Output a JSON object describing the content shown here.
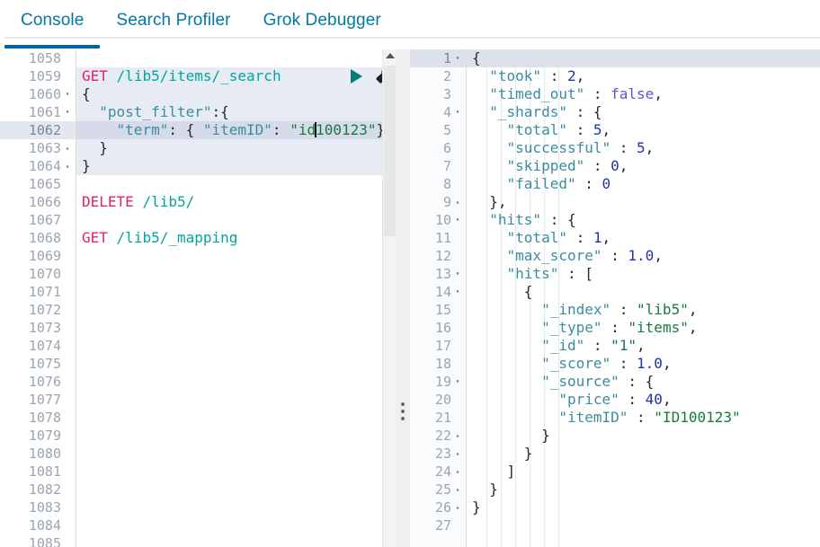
{
  "tabs": [
    {
      "label": "Console",
      "active": true
    },
    {
      "label": "Search Profiler",
      "active": false
    },
    {
      "label": "Grok Debugger",
      "active": false
    }
  ],
  "colors": {
    "accent": "#0062a6",
    "tab_text": "#0079a5",
    "method": "#e0216d",
    "url": "#00a69b",
    "json_key": "#3c8ca3",
    "string": "#177a3e",
    "number": "#2233aa",
    "boolean": "#6b4fc9",
    "play": "#017d73",
    "active_line": "#d5dbe8",
    "request_block": "#e7ebf4"
  },
  "icons": {
    "play": "play-icon",
    "wrench": "wrench-icon",
    "scroll_up": "scroll-up-arrow-icon",
    "resize_grip": "resize-grip-icon",
    "fold_open": "▾",
    "fold_close": "▴"
  },
  "request_editor": {
    "first_line_number": 1058,
    "active_line_number": 1062,
    "lines": [
      {
        "num": 1058,
        "fold": "",
        "text": "",
        "style": ""
      },
      {
        "num": 1059,
        "fold": "",
        "text": "GET /lib5/items/_search",
        "style": "req",
        "actions": true
      },
      {
        "num": 1060,
        "fold": "▾",
        "text": "{",
        "style": "req"
      },
      {
        "num": 1061,
        "fold": "▾",
        "text": "  \"post_filter\":{",
        "style": "req"
      },
      {
        "num": 1062,
        "fold": "",
        "text": "    \"term\": { \"itemID\": \"id100123\"}",
        "style": "hl"
      },
      {
        "num": 1063,
        "fold": "▴",
        "text": "  }",
        "style": "req"
      },
      {
        "num": 1064,
        "fold": "▴",
        "text": "}",
        "style": "req"
      },
      {
        "num": 1065,
        "fold": "",
        "text": "",
        "style": ""
      },
      {
        "num": 1066,
        "fold": "",
        "text": "DELETE /lib5/",
        "style": ""
      },
      {
        "num": 1067,
        "fold": "",
        "text": "",
        "style": ""
      },
      {
        "num": 1068,
        "fold": "",
        "text": "GET /lib5/_mapping",
        "style": ""
      },
      {
        "num": 1069,
        "fold": "",
        "text": "",
        "style": ""
      },
      {
        "num": 1070,
        "fold": "",
        "text": "",
        "style": ""
      },
      {
        "num": 1071,
        "fold": "",
        "text": "",
        "style": ""
      },
      {
        "num": 1072,
        "fold": "",
        "text": "",
        "style": ""
      },
      {
        "num": 1073,
        "fold": "",
        "text": "",
        "style": ""
      },
      {
        "num": 1074,
        "fold": "",
        "text": "",
        "style": ""
      },
      {
        "num": 1075,
        "fold": "",
        "text": "",
        "style": ""
      },
      {
        "num": 1076,
        "fold": "",
        "text": "",
        "style": ""
      },
      {
        "num": 1077,
        "fold": "",
        "text": "",
        "style": ""
      },
      {
        "num": 1078,
        "fold": "",
        "text": "",
        "style": ""
      },
      {
        "num": 1079,
        "fold": "",
        "text": "",
        "style": ""
      },
      {
        "num": 1080,
        "fold": "",
        "text": "",
        "style": ""
      },
      {
        "num": 1081,
        "fold": "",
        "text": "",
        "style": ""
      },
      {
        "num": 1082,
        "fold": "",
        "text": "",
        "style": ""
      },
      {
        "num": 1083,
        "fold": "",
        "text": "",
        "style": ""
      },
      {
        "num": 1084,
        "fold": "",
        "text": "",
        "style": ""
      },
      {
        "num": 1085,
        "fold": "",
        "text": "",
        "style": ""
      }
    ],
    "request": {
      "method": "GET",
      "path": "/lib5/items/_search",
      "body_line_1": "{",
      "body_line_2": "  \"post_filter\":{",
      "body_line_3_before_caret": "    \"term\": { \"itemID\": \"id",
      "body_line_3_after_caret": "100123\"}",
      "body_line_4": "  }",
      "body_line_5": "}"
    },
    "other_requests": [
      {
        "method": "DELETE",
        "path": "/lib5/"
      },
      {
        "method": "GET",
        "path": "/lib5/_mapping"
      }
    ]
  },
  "response_editor": {
    "active_line_number": 1,
    "lines": [
      {
        "num": 1,
        "fold": "▾",
        "segs": [
          {
            "t": "{",
            "c": "p"
          }
        ],
        "hl": true
      },
      {
        "num": 2,
        "fold": "",
        "segs": [
          {
            "t": "  ",
            "c": "p"
          },
          {
            "t": "\"took\"",
            "c": "k"
          },
          {
            "t": " : ",
            "c": "p"
          },
          {
            "t": "2",
            "c": "n"
          },
          {
            "t": ",",
            "c": "p"
          }
        ]
      },
      {
        "num": 3,
        "fold": "",
        "segs": [
          {
            "t": "  ",
            "c": "p"
          },
          {
            "t": "\"timed_out\"",
            "c": "k"
          },
          {
            "t": " : ",
            "c": "p"
          },
          {
            "t": "false",
            "c": "b"
          },
          {
            "t": ",",
            "c": "p"
          }
        ]
      },
      {
        "num": 4,
        "fold": "▾",
        "segs": [
          {
            "t": "  ",
            "c": "p"
          },
          {
            "t": "\"_shards\"",
            "c": "k"
          },
          {
            "t": " : {",
            "c": "p"
          }
        ]
      },
      {
        "num": 5,
        "fold": "",
        "segs": [
          {
            "t": "    ",
            "c": "p"
          },
          {
            "t": "\"total\"",
            "c": "k"
          },
          {
            "t": " : ",
            "c": "p"
          },
          {
            "t": "5",
            "c": "n"
          },
          {
            "t": ",",
            "c": "p"
          }
        ]
      },
      {
        "num": 6,
        "fold": "",
        "segs": [
          {
            "t": "    ",
            "c": "p"
          },
          {
            "t": "\"successful\"",
            "c": "k"
          },
          {
            "t": " : ",
            "c": "p"
          },
          {
            "t": "5",
            "c": "n"
          },
          {
            "t": ",",
            "c": "p"
          }
        ]
      },
      {
        "num": 7,
        "fold": "",
        "segs": [
          {
            "t": "    ",
            "c": "p"
          },
          {
            "t": "\"skipped\"",
            "c": "k"
          },
          {
            "t": " : ",
            "c": "p"
          },
          {
            "t": "0",
            "c": "n"
          },
          {
            "t": ",",
            "c": "p"
          }
        ]
      },
      {
        "num": 8,
        "fold": "",
        "segs": [
          {
            "t": "    ",
            "c": "p"
          },
          {
            "t": "\"failed\"",
            "c": "k"
          },
          {
            "t": " : ",
            "c": "p"
          },
          {
            "t": "0",
            "c": "n"
          }
        ]
      },
      {
        "num": 9,
        "fold": "▴",
        "segs": [
          {
            "t": "  },",
            "c": "p"
          }
        ]
      },
      {
        "num": 10,
        "fold": "▾",
        "segs": [
          {
            "t": "  ",
            "c": "p"
          },
          {
            "t": "\"hits\"",
            "c": "k"
          },
          {
            "t": " : {",
            "c": "p"
          }
        ]
      },
      {
        "num": 11,
        "fold": "",
        "segs": [
          {
            "t": "    ",
            "c": "p"
          },
          {
            "t": "\"total\"",
            "c": "k"
          },
          {
            "t": " : ",
            "c": "p"
          },
          {
            "t": "1",
            "c": "n"
          },
          {
            "t": ",",
            "c": "p"
          }
        ]
      },
      {
        "num": 12,
        "fold": "",
        "segs": [
          {
            "t": "    ",
            "c": "p"
          },
          {
            "t": "\"max_score\"",
            "c": "k"
          },
          {
            "t": " : ",
            "c": "p"
          },
          {
            "t": "1.0",
            "c": "n"
          },
          {
            "t": ",",
            "c": "p"
          }
        ]
      },
      {
        "num": 13,
        "fold": "▾",
        "segs": [
          {
            "t": "    ",
            "c": "p"
          },
          {
            "t": "\"hits\"",
            "c": "k"
          },
          {
            "t": " : [",
            "c": "p"
          }
        ]
      },
      {
        "num": 14,
        "fold": "▾",
        "segs": [
          {
            "t": "      {",
            "c": "p"
          }
        ]
      },
      {
        "num": 15,
        "fold": "",
        "segs": [
          {
            "t": "        ",
            "c": "p"
          },
          {
            "t": "\"_index\"",
            "c": "k"
          },
          {
            "t": " : ",
            "c": "p"
          },
          {
            "t": "\"lib5\"",
            "c": "s"
          },
          {
            "t": ",",
            "c": "p"
          }
        ]
      },
      {
        "num": 16,
        "fold": "",
        "segs": [
          {
            "t": "        ",
            "c": "p"
          },
          {
            "t": "\"_type\"",
            "c": "k"
          },
          {
            "t": " : ",
            "c": "p"
          },
          {
            "t": "\"items\"",
            "c": "s"
          },
          {
            "t": ",",
            "c": "p"
          }
        ]
      },
      {
        "num": 17,
        "fold": "",
        "segs": [
          {
            "t": "        ",
            "c": "p"
          },
          {
            "t": "\"_id\"",
            "c": "k"
          },
          {
            "t": " : ",
            "c": "p"
          },
          {
            "t": "\"1\"",
            "c": "s"
          },
          {
            "t": ",",
            "c": "p"
          }
        ]
      },
      {
        "num": 18,
        "fold": "",
        "segs": [
          {
            "t": "        ",
            "c": "p"
          },
          {
            "t": "\"_score\"",
            "c": "k"
          },
          {
            "t": " : ",
            "c": "p"
          },
          {
            "t": "1.0",
            "c": "n"
          },
          {
            "t": ",",
            "c": "p"
          }
        ]
      },
      {
        "num": 19,
        "fold": "▾",
        "segs": [
          {
            "t": "        ",
            "c": "p"
          },
          {
            "t": "\"_source\"",
            "c": "k"
          },
          {
            "t": " : {",
            "c": "p"
          }
        ]
      },
      {
        "num": 20,
        "fold": "",
        "segs": [
          {
            "t": "          ",
            "c": "p"
          },
          {
            "t": "\"price\"",
            "c": "k"
          },
          {
            "t": " : ",
            "c": "p"
          },
          {
            "t": "40",
            "c": "n"
          },
          {
            "t": ",",
            "c": "p"
          }
        ]
      },
      {
        "num": 21,
        "fold": "",
        "segs": [
          {
            "t": "          ",
            "c": "p"
          },
          {
            "t": "\"itemID\"",
            "c": "k"
          },
          {
            "t": " : ",
            "c": "p"
          },
          {
            "t": "\"ID100123\"",
            "c": "s"
          }
        ]
      },
      {
        "num": 22,
        "fold": "▴",
        "segs": [
          {
            "t": "        }",
            "c": "p"
          }
        ]
      },
      {
        "num": 23,
        "fold": "▴",
        "segs": [
          {
            "t": "      }",
            "c": "p"
          }
        ]
      },
      {
        "num": 24,
        "fold": "▴",
        "segs": [
          {
            "t": "    ]",
            "c": "p"
          }
        ]
      },
      {
        "num": 25,
        "fold": "▴",
        "segs": [
          {
            "t": "  }",
            "c": "p"
          }
        ]
      },
      {
        "num": 26,
        "fold": "▴",
        "segs": [
          {
            "t": "}",
            "c": "p"
          }
        ]
      },
      {
        "num": 27,
        "fold": "",
        "segs": []
      }
    ],
    "response_json": {
      "took": 2,
      "timed_out": false,
      "_shards": {
        "total": 5,
        "successful": 5,
        "skipped": 0,
        "failed": 0
      },
      "hits": {
        "total": 1,
        "max_score": 1.0,
        "hits": [
          {
            "_index": "lib5",
            "_type": "items",
            "_id": "1",
            "_score": 1.0,
            "_source": {
              "price": 40,
              "itemID": "ID100123"
            }
          }
        ]
      }
    }
  }
}
